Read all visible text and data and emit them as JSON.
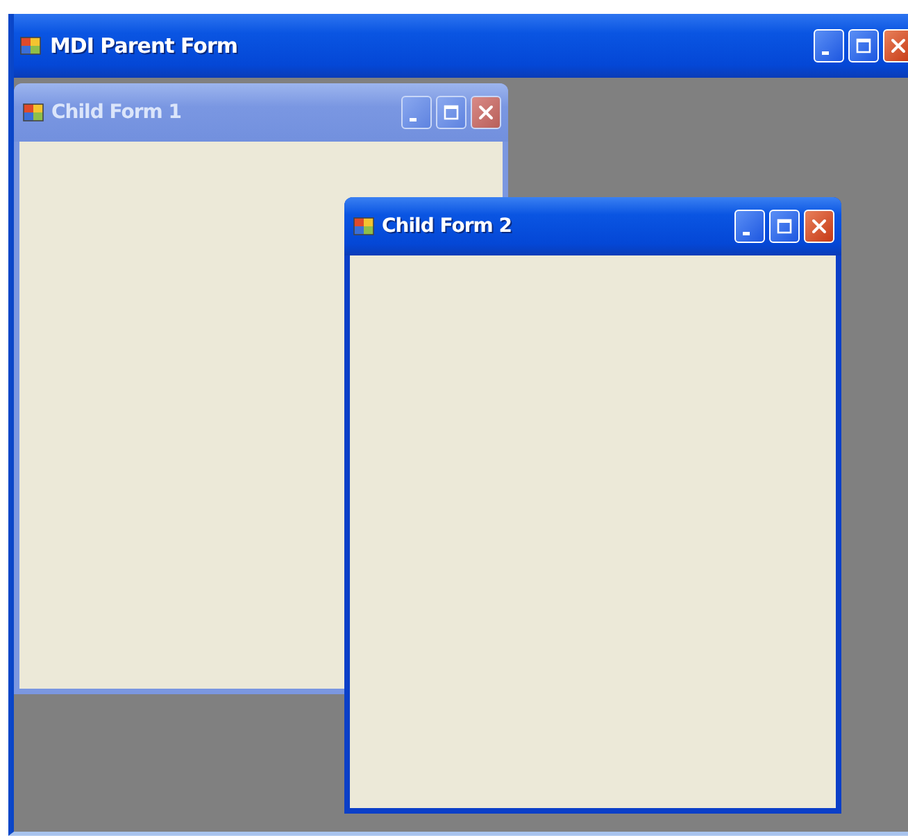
{
  "window": {
    "title": "MDI Parent Form"
  },
  "child_windows": [
    {
      "title": "Child Form 1",
      "active": false
    },
    {
      "title": "Child Form 2",
      "active": true
    }
  ]
}
